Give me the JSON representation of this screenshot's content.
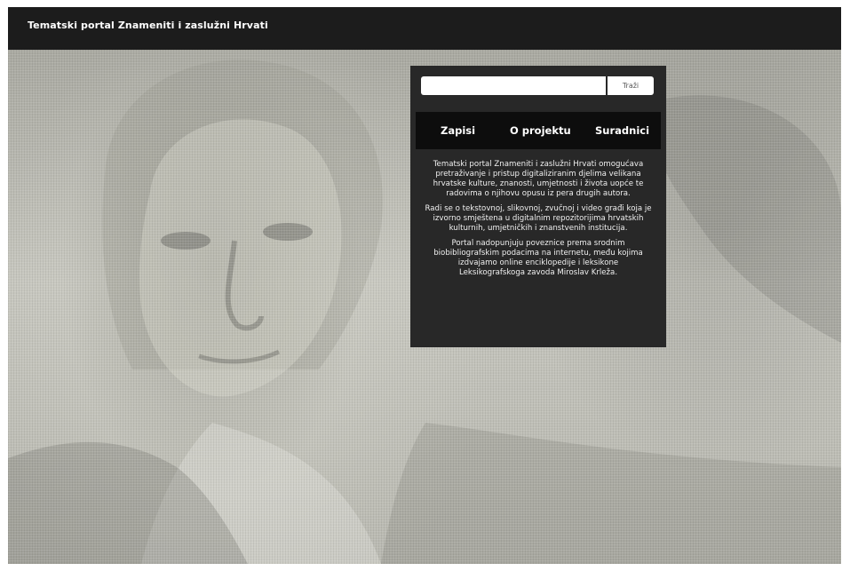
{
  "header": {
    "site_title": "Tematski portal Znameniti i zaslužni Hrvati"
  },
  "search": {
    "value": "",
    "placeholder": "",
    "button_label": "Traži"
  },
  "nav": {
    "items": [
      {
        "label": "Zapisi"
      },
      {
        "label": "O projektu"
      },
      {
        "label": "Suradnici"
      }
    ]
  },
  "description": {
    "paragraphs": [
      "Tematski portal Znameniti i zaslužni Hrvati omogućava pretraživanje i pristup digitaliziranim djelima velikana hrvatske kulture, znanosti, umjetnosti i života uopće te radovima o njihovu opusu iz pera drugih autora.",
      "Radi se o tekstovnoj, slikovnoj, zvučnoj i video građi koja je izvorno smještena u digitalnim repozitorijima hrvatskih kulturnih, umjetničkih i znanstvenih institucija.",
      "Portal nadopunjuju poveznice prema srodnim biobibliografskim podacima na internetu, među kojima izdvajamo online enciklopedije i leksikone Leksikografskoga zavoda Miroslav Krleža."
    ]
  },
  "colors": {
    "topbar": "#1c1c1c",
    "panel": "#282828",
    "nav": "#0d0d0d"
  }
}
